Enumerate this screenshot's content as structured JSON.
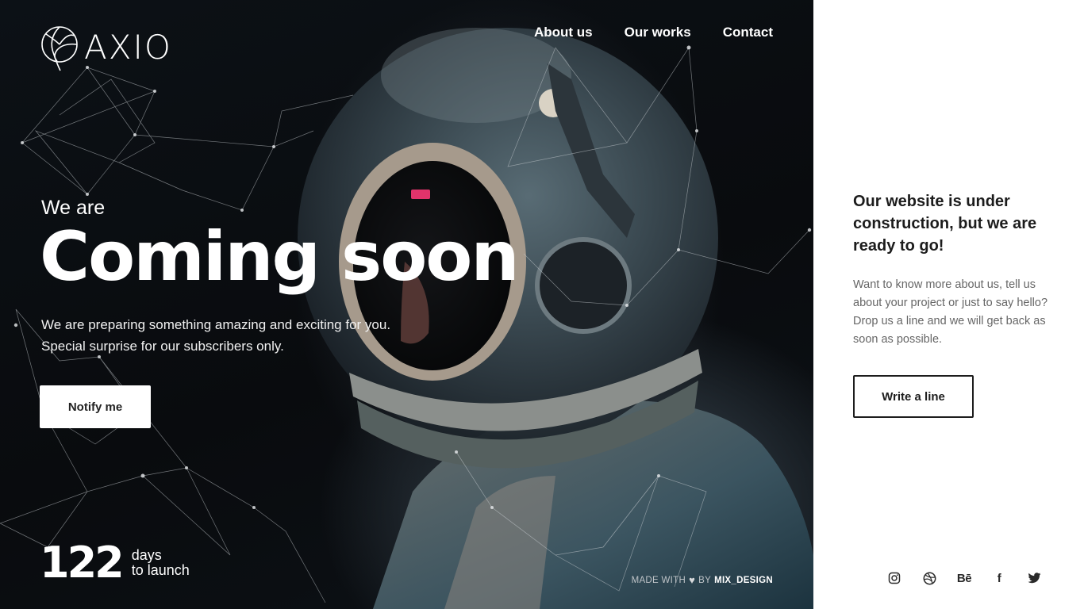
{
  "logo": {
    "wordmark": "AXIO"
  },
  "nav": {
    "items": [
      {
        "label": "About us"
      },
      {
        "label": "Our works"
      },
      {
        "label": "Contact"
      }
    ]
  },
  "hero": {
    "intro": "We are",
    "headline": "Coming soon",
    "description": [
      "We are preparing something amazing and exciting for you.",
      "Special surprise for our subscribers only."
    ],
    "notify_label": "Notify me"
  },
  "countdown": {
    "number": "122",
    "unit": "days",
    "suffix": "to launch"
  },
  "credit": {
    "prefix": "MADE WITH",
    "by": "BY",
    "brand": "MIX_DESIGN"
  },
  "panel": {
    "title": "Our website is under construction, but we are ready to go!",
    "text": "Want to know more about us, tell us about your project or just to say hello? Drop us a line and we will get back as soon as possible.",
    "button_label": "Write a line"
  },
  "socials": [
    {
      "icon": "instagram-icon"
    },
    {
      "icon": "dribbble-icon"
    },
    {
      "icon": "behance-icon",
      "text": "Bē"
    },
    {
      "icon": "facebook-icon",
      "text": "f"
    },
    {
      "icon": "twitter-icon"
    }
  ],
  "colors": {
    "hero_bg": "#0b0e12",
    "text_light": "#ffffff",
    "panel_bg": "#ffffff",
    "panel_text": "#1c1c1c",
    "panel_muted": "#666666"
  }
}
